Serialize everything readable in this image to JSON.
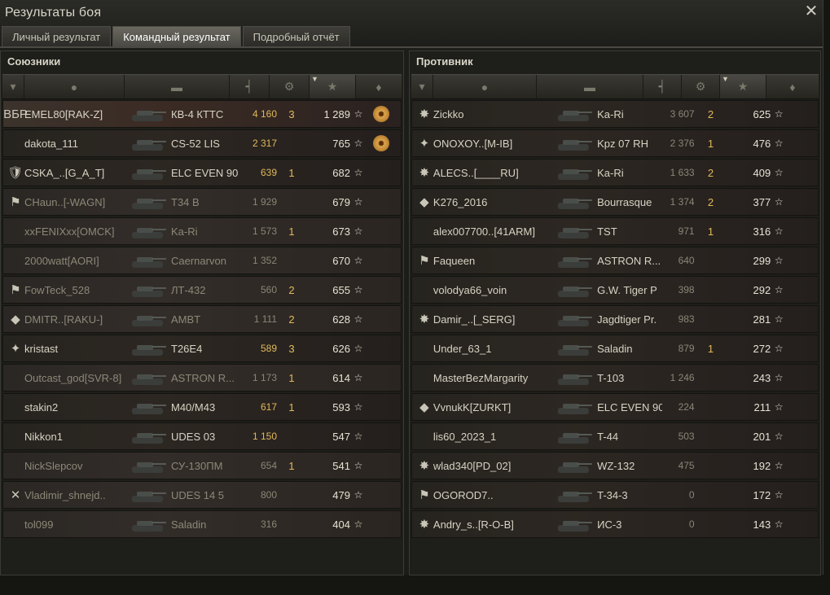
{
  "window": {
    "title": "Результаты боя"
  },
  "tabs": [
    {
      "label": "Личный результат",
      "active": false
    },
    {
      "label": "Командный результат",
      "active": true
    },
    {
      "label": "Подробный отчёт",
      "active": false
    }
  ],
  "allies": {
    "title": "Союзники",
    "rows": [
      {
        "icon": "ВБР",
        "name": "EMEL80[RAK-Z]",
        "vehicle": "КВ-4 КТТС",
        "damage": "4 160",
        "dmg_hi": true,
        "kills": "3",
        "xp": "1 289",
        "medal": true,
        "state": "me"
      },
      {
        "icon": "",
        "name": "dakota_111",
        "vehicle": "CS-52 LIS",
        "damage": "2 317",
        "dmg_hi": true,
        "kills": "",
        "xp": "765",
        "medal": true,
        "state": "alive"
      },
      {
        "icon": "🛡",
        "name": "CSKA_..[G_A_T]",
        "vehicle": "ELC EVEN 90",
        "damage": "639",
        "dmg_hi": true,
        "kills": "1",
        "xp": "682",
        "medal": false,
        "state": "alive"
      },
      {
        "icon": "⚑",
        "name": "CHaun..[-WAGN]",
        "vehicle": "T34 B",
        "damage": "1 929",
        "dmg_hi": false,
        "kills": "",
        "xp": "679",
        "medal": false,
        "state": "dead"
      },
      {
        "icon": "",
        "name": "xxFENIXxx[OMCK]",
        "vehicle": "Ka-Ri",
        "damage": "1 573",
        "dmg_hi": false,
        "kills": "1",
        "xp": "673",
        "medal": false,
        "state": "dead"
      },
      {
        "icon": "",
        "name": "2000watt[AORI]",
        "vehicle": "Caernarvon",
        "damage": "1 352",
        "dmg_hi": false,
        "kills": "",
        "xp": "670",
        "medal": false,
        "state": "dead"
      },
      {
        "icon": "⚑",
        "name": "FowTeck_528",
        "vehicle": "ЛТ-432",
        "damage": "560",
        "dmg_hi": false,
        "kills": "2",
        "xp": "655",
        "medal": false,
        "state": "dead"
      },
      {
        "icon": "◆",
        "name": "DMITR..[RAKU-]",
        "vehicle": "AMBT",
        "damage": "1 111",
        "dmg_hi": false,
        "kills": "2",
        "xp": "628",
        "medal": false,
        "state": "dead"
      },
      {
        "icon": "✦",
        "name": "kristast",
        "vehicle": "T26E4",
        "damage": "589",
        "dmg_hi": true,
        "kills": "3",
        "xp": "626",
        "medal": false,
        "state": "alive"
      },
      {
        "icon": "",
        "name": "Outcast_god[SVR-8]",
        "vehicle": "ASTRON R...",
        "damage": "1 173",
        "dmg_hi": false,
        "kills": "1",
        "xp": "614",
        "medal": false,
        "state": "dead"
      },
      {
        "icon": "",
        "name": "stakin2",
        "vehicle": "M40/M43",
        "damage": "617",
        "dmg_hi": true,
        "kills": "1",
        "xp": "593",
        "medal": false,
        "state": "alive"
      },
      {
        "icon": "",
        "name": "Nikkon1",
        "vehicle": "UDES 03",
        "damage": "1 150",
        "dmg_hi": true,
        "kills": "",
        "xp": "547",
        "medal": false,
        "state": "alive"
      },
      {
        "icon": "",
        "name": "NickSlepcov",
        "vehicle": "СУ-130ПМ",
        "damage": "654",
        "dmg_hi": false,
        "kills": "1",
        "xp": "541",
        "medal": false,
        "state": "dead"
      },
      {
        "icon": "✕",
        "name": "Vladimir_shnejd..",
        "vehicle": "UDES 14 5",
        "damage": "800",
        "dmg_hi": false,
        "kills": "",
        "xp": "479",
        "medal": false,
        "state": "dead"
      },
      {
        "icon": "",
        "name": "tol099",
        "vehicle": "Saladin",
        "damage": "316",
        "dmg_hi": false,
        "kills": "",
        "xp": "404",
        "medal": false,
        "state": "dead"
      }
    ]
  },
  "enemies": {
    "title": "Противник",
    "rows": [
      {
        "icon": "✸",
        "name": "Zickko",
        "vehicle": "Ka-Ri",
        "damage": "3 607",
        "kills": "2",
        "xp": "625"
      },
      {
        "icon": "✦",
        "name": "ONOXOY..[M-IB]",
        "vehicle": "Kpz 07 RH",
        "damage": "2 376",
        "kills": "1",
        "xp": "476"
      },
      {
        "icon": "✸",
        "name": "ALECS..[____RU]",
        "vehicle": "Ka-Ri",
        "damage": "1 633",
        "kills": "2",
        "xp": "409"
      },
      {
        "icon": "◆",
        "name": "K276_2016",
        "vehicle": "Bourrasque",
        "damage": "1 374",
        "kills": "2",
        "xp": "377"
      },
      {
        "icon": "",
        "name": "alex007700..[41ARM]",
        "vehicle": "TST",
        "damage": "971",
        "kills": "1",
        "xp": "316"
      },
      {
        "icon": "⚑",
        "name": "Faqueen",
        "vehicle": "ASTRON R...",
        "damage": "640",
        "kills": "",
        "xp": "299"
      },
      {
        "icon": "",
        "name": "volodya66_voin",
        "vehicle": "G.W. Tiger P",
        "damage": "398",
        "kills": "",
        "xp": "292"
      },
      {
        "icon": "✸",
        "name": "Damir_..[_SERG]",
        "vehicle": "Jagdtiger Pr.",
        "damage": "983",
        "kills": "",
        "xp": "281"
      },
      {
        "icon": "",
        "name": "Under_63_1",
        "vehicle": "Saladin",
        "damage": "879",
        "kills": "1",
        "xp": "272"
      },
      {
        "icon": "",
        "name": "MasterBezMargarity",
        "vehicle": "T-103",
        "damage": "1 246",
        "kills": "",
        "xp": "243"
      },
      {
        "icon": "◆",
        "name": "VvnukK[ZURKT]",
        "vehicle": "ELC EVEN 90",
        "damage": "224",
        "kills": "",
        "xp": "211"
      },
      {
        "icon": "",
        "name": "lis60_2023_1",
        "vehicle": "T-44",
        "damage": "503",
        "kills": "",
        "xp": "201"
      },
      {
        "icon": "✸",
        "name": "wlad340[PD_02]",
        "vehicle": "WZ-132",
        "damage": "475",
        "kills": "",
        "xp": "192"
      },
      {
        "icon": "⚑",
        "name": "OGOROD7..",
        "vehicle": "T-34-3",
        "damage": "0",
        "kills": "",
        "xp": "172"
      },
      {
        "icon": "✸",
        "name": "Andry_s..[R-O-B]",
        "vehicle": "ИС-3",
        "damage": "0",
        "kills": "",
        "xp": "143"
      }
    ]
  },
  "icons": {
    "xp_star": "☆",
    "medal": "✹"
  }
}
